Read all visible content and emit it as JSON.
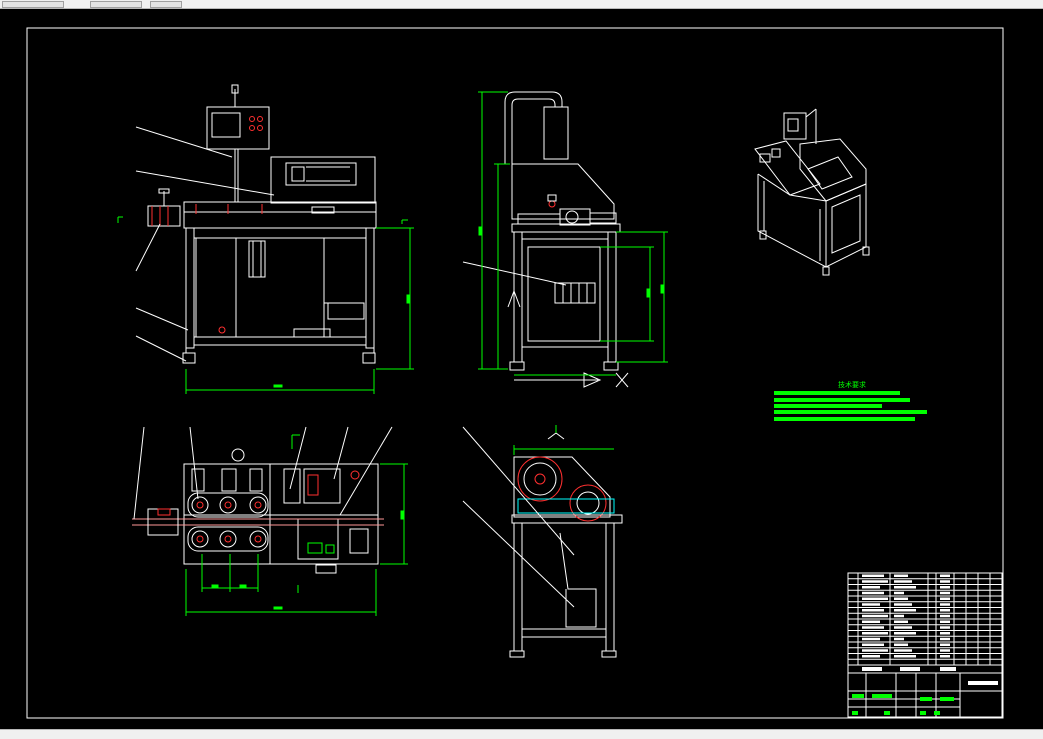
{
  "drawing": {
    "background": "#000000",
    "line_color": "#ffffff",
    "dimension_color": "#00ff00",
    "leader_color": "#ffffff",
    "highlight_color": "#ff3030",
    "accent_color": "#00ffff"
  },
  "tech_requirements": {
    "title": "技术要求",
    "lines": [
      "",
      "",
      "",
      "",
      ""
    ]
  },
  "title_block": {
    "drawing_name": "",
    "bom_rows": 16
  }
}
